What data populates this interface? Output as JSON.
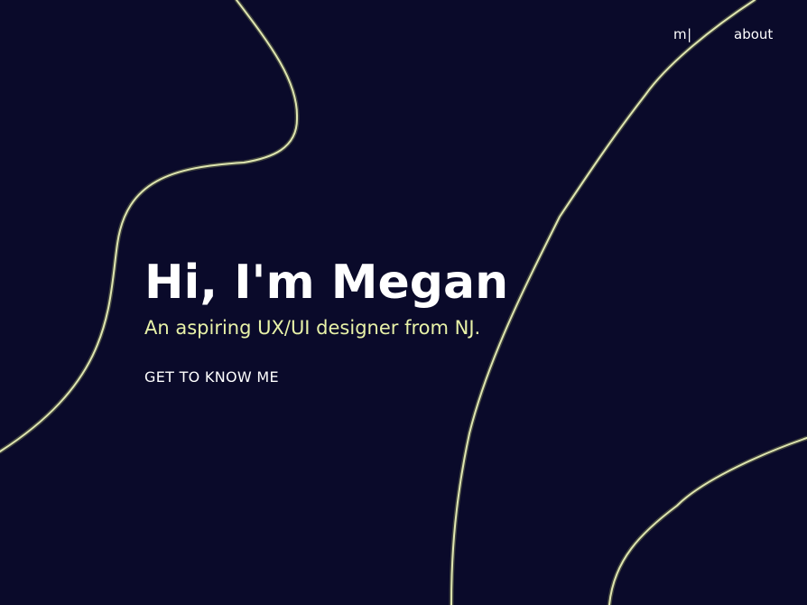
{
  "nav": {
    "logo": "m|",
    "about_label": "about"
  },
  "hero": {
    "title": "Hi, I'm Megan",
    "subtitle": "An aspiring UX/UI designer from NJ.",
    "cta_label": "GET TO KNOW ME"
  },
  "colors": {
    "background": "#0a0a2a",
    "accent": "#e8f2a8",
    "text": "#ffffff",
    "curve": "#dfe6b0"
  }
}
